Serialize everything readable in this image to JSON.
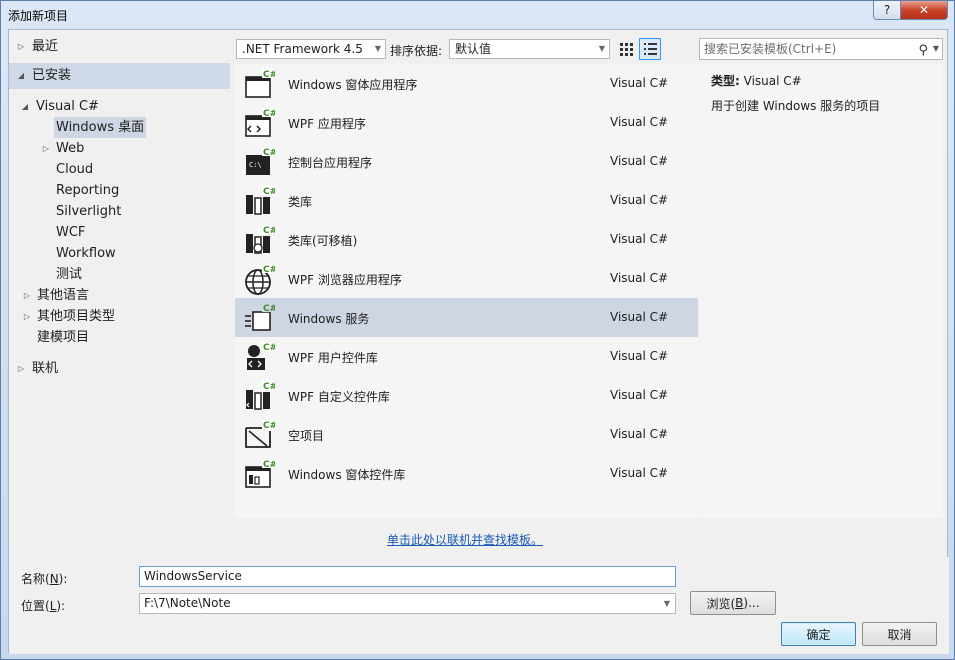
{
  "window": {
    "title": "添加新项目",
    "help_glyph": "?",
    "close_glyph": "✕"
  },
  "tree": {
    "recent": "最近",
    "installed": "已安装",
    "visual_csharp": "Visual C#",
    "children": [
      "Windows 桌面",
      "Web",
      "Cloud",
      "Reporting",
      "Silverlight",
      "WCF",
      "Workflow",
      "测试"
    ],
    "other_languages": "其他语言",
    "other_project_types": "其他项目类型",
    "modeling_projects": "建模项目",
    "online": "联机"
  },
  "toolbar": {
    "framework": ".NET Framework 4.5",
    "sort_label": "排序依据:",
    "sort_value": "默认值"
  },
  "search": {
    "placeholder": "搜索已安装模板(Ctrl+E)"
  },
  "templates": [
    {
      "name": "Windows 窗体应用程序",
      "lang": "Visual C#",
      "icon": "windows-form-app-icon"
    },
    {
      "name": "WPF 应用程序",
      "lang": "Visual C#",
      "icon": "wpf-app-icon"
    },
    {
      "name": "控制台应用程序",
      "lang": "Visual C#",
      "icon": "console-app-icon"
    },
    {
      "name": "类库",
      "lang": "Visual C#",
      "icon": "class-library-icon"
    },
    {
      "name": "类库(可移植)",
      "lang": "Visual C#",
      "icon": "portable-class-library-icon"
    },
    {
      "name": "WPF 浏览器应用程序",
      "lang": "Visual C#",
      "icon": "wpf-browser-app-icon"
    },
    {
      "name": "Windows 服务",
      "lang": "Visual C#",
      "icon": "windows-service-icon"
    },
    {
      "name": "WPF 用户控件库",
      "lang": "Visual C#",
      "icon": "wpf-user-control-library-icon"
    },
    {
      "name": "WPF 自定义控件库",
      "lang": "Visual C#",
      "icon": "wpf-custom-control-library-icon"
    },
    {
      "name": "空项目",
      "lang": "Visual C#",
      "icon": "empty-project-icon"
    },
    {
      "name": "Windows 窗体控件库",
      "lang": "Visual C#",
      "icon": "windows-forms-control-library-icon"
    }
  ],
  "selected_template": "Windows 服务",
  "info": {
    "type_label": "类型:",
    "type_value": "Visual C#",
    "description": "用于创建 Windows 服务的项目"
  },
  "online_link": "单击此处以联机并查找模板。",
  "form": {
    "name_label_pre": "名称(",
    "name_label_key": "N",
    "name_label_post": "):",
    "name_value": "WindowsService",
    "location_label_pre": "位置(",
    "location_label_key": "L",
    "location_label_post": "):",
    "location_value": "F:\\7\\Note\\Note",
    "browse_pre": "浏览(",
    "browse_key": "B",
    "browse_post": ")...",
    "ok": "确定",
    "cancel": "取消"
  },
  "colors": {
    "csharp_badge": "#3c8c28",
    "selection": "#cfd6e3",
    "link": "#1a59b5",
    "close_button": "#c8432a"
  }
}
